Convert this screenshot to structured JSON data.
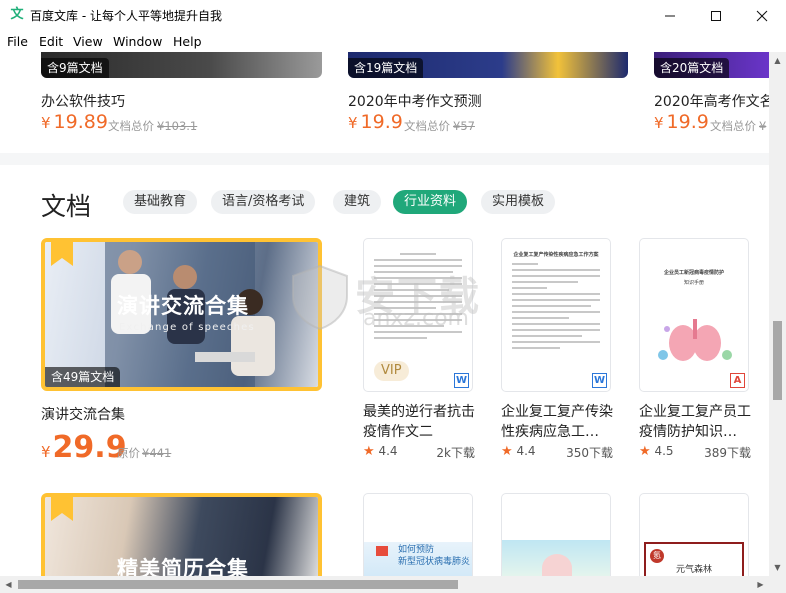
{
  "window": {
    "title": "百度文库 - 让每个人平等地提升自我",
    "app_icon_glyph": "文",
    "accent": "#20a87a"
  },
  "menu": [
    "File",
    "Edit",
    "View",
    "Window",
    "Help"
  ],
  "top_row": [
    {
      "badge": "含9篇文档",
      "title": "办公软件技巧",
      "currency": "¥",
      "price": "19.89",
      "sub_label": "文档总价",
      "orig": "¥103.1"
    },
    {
      "badge": "含19篇文档",
      "title": "2020年中考作文预测",
      "currency": "¥",
      "price": "19.9",
      "sub_label": "文档总价",
      "orig": "¥57"
    },
    {
      "badge": "含20篇文档",
      "title": "2020年高考作文名",
      "currency": "¥",
      "price": "19.9",
      "sub_label": "文档总价",
      "orig": "¥"
    }
  ],
  "docs_section": {
    "title": "文档",
    "tabs": [
      "基础教育",
      "语言/资格考试",
      "建筑",
      "行业资料",
      "实用模板"
    ],
    "active_tab": "行业资料"
  },
  "collections": [
    {
      "cover_title": "演讲交流合集",
      "cover_sub": "Exchange of speeches",
      "badge": "含49篇文档",
      "name": "演讲交流合集",
      "currency": "¥",
      "price": "29.9",
      "orig_label": "原价",
      "orig": "¥441"
    },
    {
      "cover_title": "精美简历合集"
    }
  ],
  "doc_cards": [
    {
      "title": "最美的逆行者抗击疫情作文二",
      "rating": "4.4",
      "downloads": "2k下载",
      "file_type": "W",
      "vip": "VIP"
    },
    {
      "title": "企业复工复产传染性疾病应急工…",
      "rating": "4.4",
      "downloads": "350下载",
      "file_type": "W",
      "preview_heading": "企业复工复产传染性疾病应急工作方案"
    },
    {
      "title": "企业复工复产员工疫情防护知识…",
      "rating": "4.5",
      "downloads": "389下载",
      "file_type": "A",
      "preview_heading": "企业员工新冠病毒疫情防护",
      "preview_sub": "知识手册"
    }
  ],
  "second_row_previews": [
    {
      "text": "如何预防\n新型冠状病毒肺炎"
    },
    {
      "text": ""
    },
    {
      "text": "元气森林",
      "mark": "氪"
    }
  ],
  "watermark": {
    "text": "安下载",
    "sub": "anxz.com"
  }
}
